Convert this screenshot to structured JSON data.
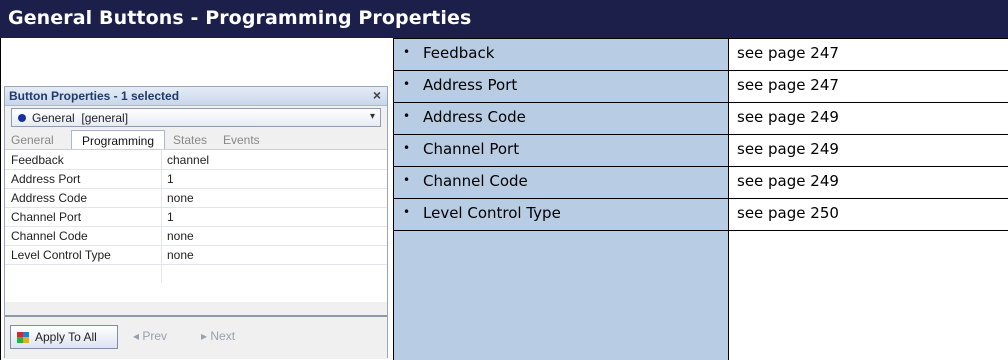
{
  "header": {
    "title": "General Buttons - Programming Properties"
  },
  "properties": [
    {
      "name": "Feedback",
      "reference": "see page 247"
    },
    {
      "name": "Address Port",
      "reference": "see page 247"
    },
    {
      "name": "Address Code",
      "reference": "see page 249"
    },
    {
      "name": "Channel Port",
      "reference": "see page 249"
    },
    {
      "name": "Channel Code",
      "reference": "see page 249"
    },
    {
      "name": "Level Control Type",
      "reference": "see page 250"
    }
  ],
  "panel": {
    "title": "Button Properties - 1 selected",
    "close_glyph": "×",
    "dropdown": {
      "value": "General  [general]",
      "arrow": "▾"
    },
    "tabs": [
      "General",
      "Programming",
      "States",
      "Events"
    ],
    "active_tab": "Programming",
    "rows": [
      {
        "key": "Feedback",
        "value": "channel"
      },
      {
        "key": "Address Port",
        "value": "1"
      },
      {
        "key": "Address Code",
        "value": "none"
      },
      {
        "key": "Channel Port",
        "value": "1"
      },
      {
        "key": "Channel Code",
        "value": "none"
      },
      {
        "key": "Level Control Type",
        "value": "none"
      }
    ],
    "apply_label": "Apply To All",
    "prev_label": "◂ Prev",
    "next_label": "▸ Next"
  },
  "colors": {
    "header_bg": "#1b1f4a",
    "property_column_bg": "#b8cce4"
  }
}
